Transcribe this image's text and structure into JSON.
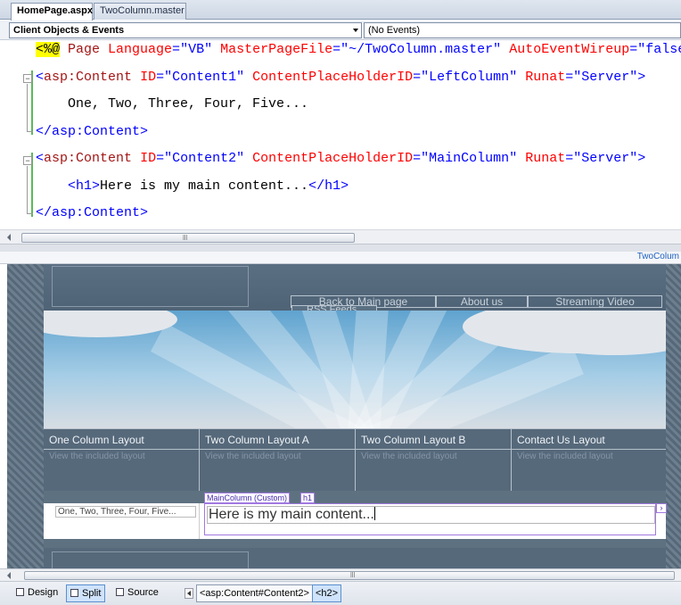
{
  "tabs": [
    {
      "label": "HomePage.aspx",
      "active": true
    },
    {
      "label": "TwoColumn.master",
      "active": false
    }
  ],
  "dropdowns": {
    "objects": "Client Objects & Events",
    "events": "(No Events)"
  },
  "code": {
    "line1": {
      "marker": "<%@",
      "rest_tag": " Page ",
      "a1": "Language",
      "eq": "=",
      "v1": "\"VB\"",
      "a2": "MasterPageFile",
      "v2": "\"~/TwoColumn.master\"",
      "a3": "AutoEventWireup",
      "v3": "\"false"
    },
    "content1": {
      "open": "<",
      "tag": "asp:Content",
      "a1": "ID",
      "v1": "\"Content1\"",
      "a2": "ContentPlaceHolderID",
      "v2": "\"LeftColumn\"",
      "a3": "Runat",
      "v3": "\"Server\"",
      "close": ">"
    },
    "content1_text": "One, Two, Three, Four, Five...",
    "content1_end": "</asp:Content>",
    "content2": {
      "open": "<",
      "tag": "asp:Content",
      "a1": "ID",
      "v1": "\"Content2\"",
      "a2": "ContentPlaceHolderID",
      "v2": "\"MainColumn\"",
      "a3": "Runat",
      "v3": "\"Server\"",
      "close": ">"
    },
    "h1_open": "<h1>",
    "h1_text": "Here is my main content...",
    "h1_close": "</h1>",
    "content2_end": "</asp:Content>"
  },
  "master_link": "TwoColum",
  "design": {
    "nav": [
      "Back to Main page",
      "About us",
      "Streaming Video"
    ],
    "rss": "RSS Feeds",
    "columns": [
      {
        "title": "One Column Layout",
        "sub": "View the included layout"
      },
      {
        "title": "Two Column Layout A",
        "sub": "View the included layout"
      },
      {
        "title": "Two Column Layout B",
        "sub": "View the included layout"
      },
      {
        "title": "Contact Us Layout",
        "sub": "View the included layout"
      }
    ],
    "chip_main": "MainColumn (Custom)",
    "chip_h1": "h1",
    "left_text": "One, Two, Three, Four, Five...",
    "main_text": "Here is my main content...",
    "smart_tag": "›"
  },
  "status": {
    "views": [
      {
        "label": "Design",
        "active": false
      },
      {
        "label": "Split",
        "active": true
      },
      {
        "label": "Source",
        "active": false
      }
    ],
    "crumbs": [
      {
        "label": "<asp:Content#Content2>",
        "selected": false
      },
      {
        "label": "<h2>",
        "selected": true
      }
    ]
  },
  "colors": {
    "accent": "#a179e0",
    "tag": "#a31515",
    "attr": "#ff0000",
    "value": "#0000ff"
  }
}
